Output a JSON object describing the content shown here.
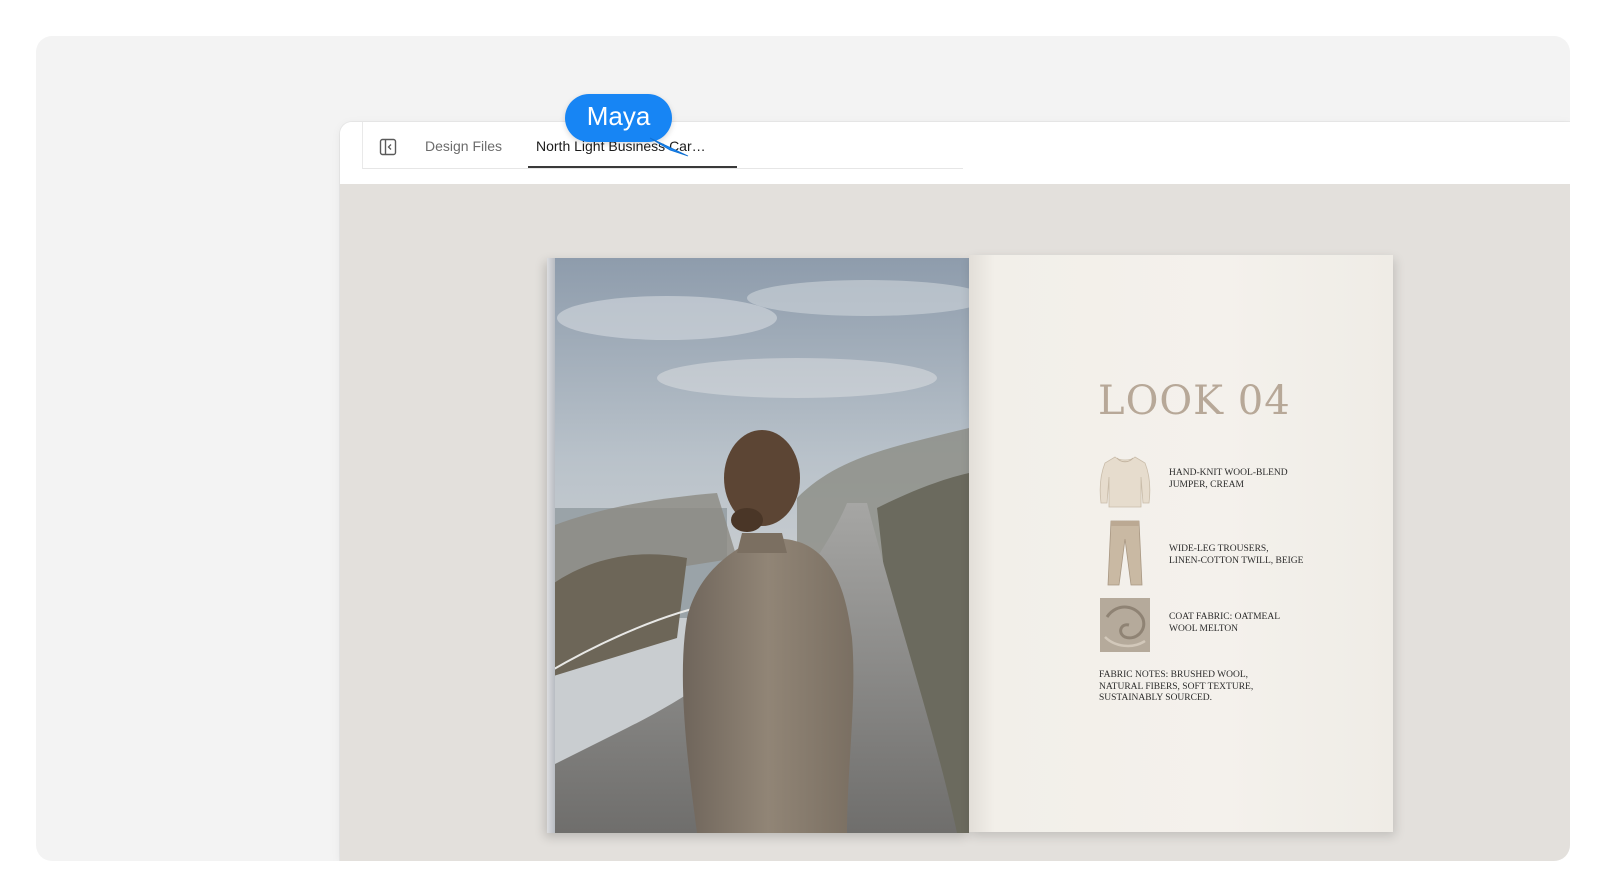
{
  "tabbar": {
    "tabs": [
      {
        "label": "Design Files",
        "active": false
      },
      {
        "label": "North Light Business Car…",
        "active": true
      }
    ]
  },
  "collaborator": {
    "name": "Maya",
    "color": "#1785f4"
  },
  "document": {
    "look_title": "LOOK 04",
    "items": [
      {
        "icon": "jumper-icon",
        "caption": "HAND-KNIT WOOL-BLEND\nJUMPER, CREAM"
      },
      {
        "icon": "trousers-icon",
        "caption": "WIDE-LEG TROUSERS,\nLINEN-COTTON TWILL, BEIGE"
      },
      {
        "icon": "fabric-swatch-icon",
        "caption": "COAT FABRIC: OATMEAL\nWOOL MELTON"
      }
    ],
    "fabric_notes": "FABRIC NOTES: BRUSHED WOOL,\nNATURAL FIBERS, SOFT TEXTURE,\nSUSTAINABLY SOURCED."
  },
  "colors": {
    "canvas": "#e3e0dc",
    "title_accent": "#b7a898"
  }
}
